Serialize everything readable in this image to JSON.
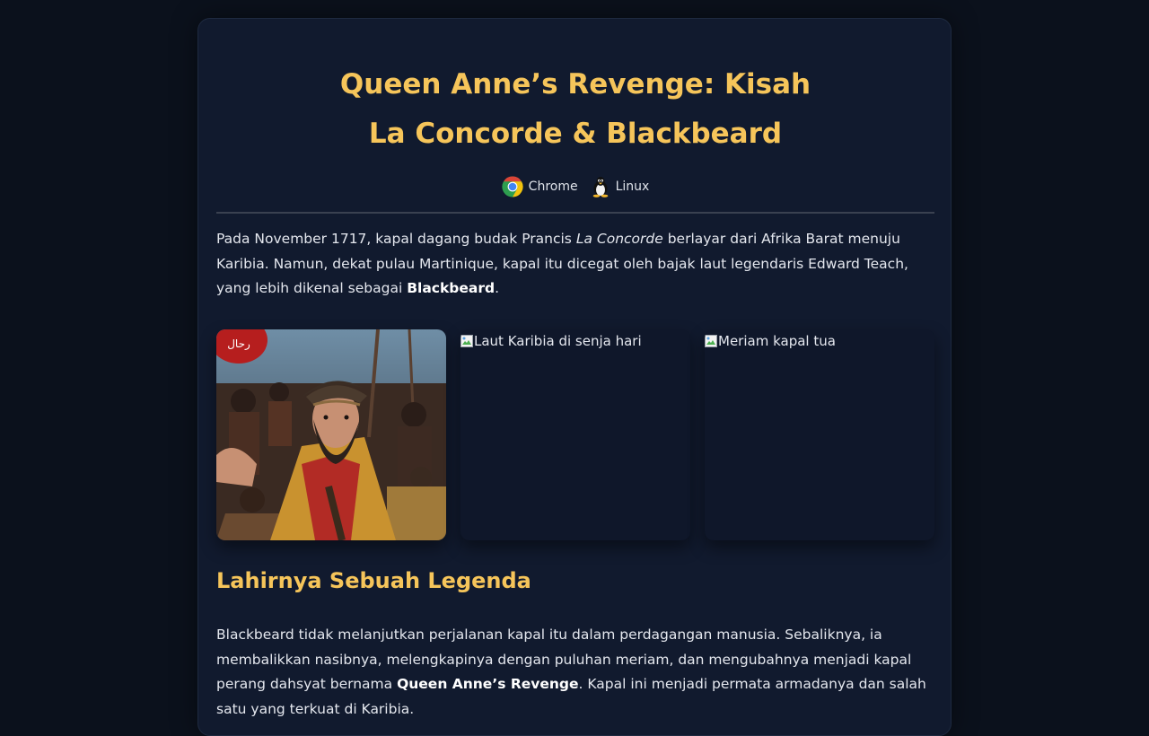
{
  "article": {
    "title_line1": "Queen Anne’s Revenge: Kisah",
    "title_line2": "La Concorde & Blackbeard",
    "badges": [
      {
        "icon": "chrome-icon",
        "label": "Chrome"
      },
      {
        "icon": "linux-tux-icon",
        "label": "Linux"
      }
    ],
    "intro": {
      "text_before": "Pada November 1717, kapal dagang budak Prancis ",
      "ship_name": "La Concorde",
      "text_middle": " berlayar dari Afrika Barat menuju Karibia. Namun, dekat pulau Martinique, kapal itu dicegat oleh bajak laut legendaris Edward Teach, yang lebih dikenal sebagai ",
      "pirate_name": "Blackbeard",
      "text_after": "."
    },
    "gallery": [
      {
        "alt": "",
        "status": "loaded",
        "badge_text": "رحال"
      },
      {
        "alt": "Laut Karibia di senja hari",
        "status": "broken"
      },
      {
        "alt": "Meriam kapal tua",
        "status": "broken"
      }
    ],
    "section1": {
      "heading": "Lahirnya Sebuah Legenda",
      "text_before": "Blackbeard tidak melanjutkan perjalanan kapal itu dalam perdagangan manusia. Sebaliknya, ia membalikkan nasibnya, melengkapinya dengan puluhan meriam, dan mengubahnya menjadi kapal perang dahsyat bernama ",
      "ship_new_name": "Queen Anne’s Revenge",
      "text_after": ". Kapal ini menjadi permata armadanya dan salah satu yang terkuat di Karibia."
    }
  },
  "theme": {
    "background": "#0b111c",
    "card": "#111a2e",
    "accent": "#f6c55a",
    "text": "#e4e7ee"
  }
}
